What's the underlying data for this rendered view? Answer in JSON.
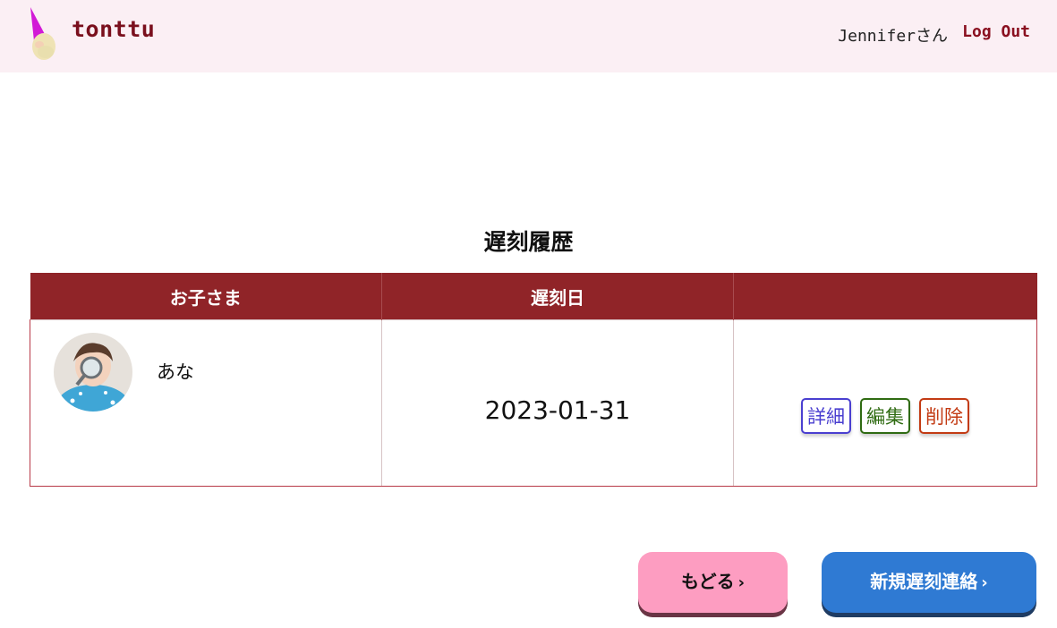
{
  "header": {
    "brand": "tonttu",
    "user_greeting": "Jenniferさん",
    "logout_label": "Log Out"
  },
  "main": {
    "title": "遅刻履歴",
    "table": {
      "columns": [
        "お子さま",
        "遅刻日",
        ""
      ],
      "rows": [
        {
          "child_name": "あな",
          "date": "2023-01-31",
          "actions": {
            "detail": "詳細",
            "edit": "編集",
            "delete": "削除"
          }
        }
      ]
    }
  },
  "footer": {
    "back_label": "もどる",
    "new_label": "新規遅刻連絡",
    "chevron": "›"
  },
  "colors": {
    "header_bg": "#fbeff4",
    "brand": "#7a0f1d",
    "table_header": "#902428",
    "detail": "#4a3fd0",
    "edit": "#2f6b12",
    "delete": "#c33b14",
    "back_btn": "#fd9dc1",
    "new_btn": "#2f7ad3"
  },
  "icons": [
    "gnome-logo-icon",
    "child-avatar",
    "chevron-right-icon"
  ]
}
